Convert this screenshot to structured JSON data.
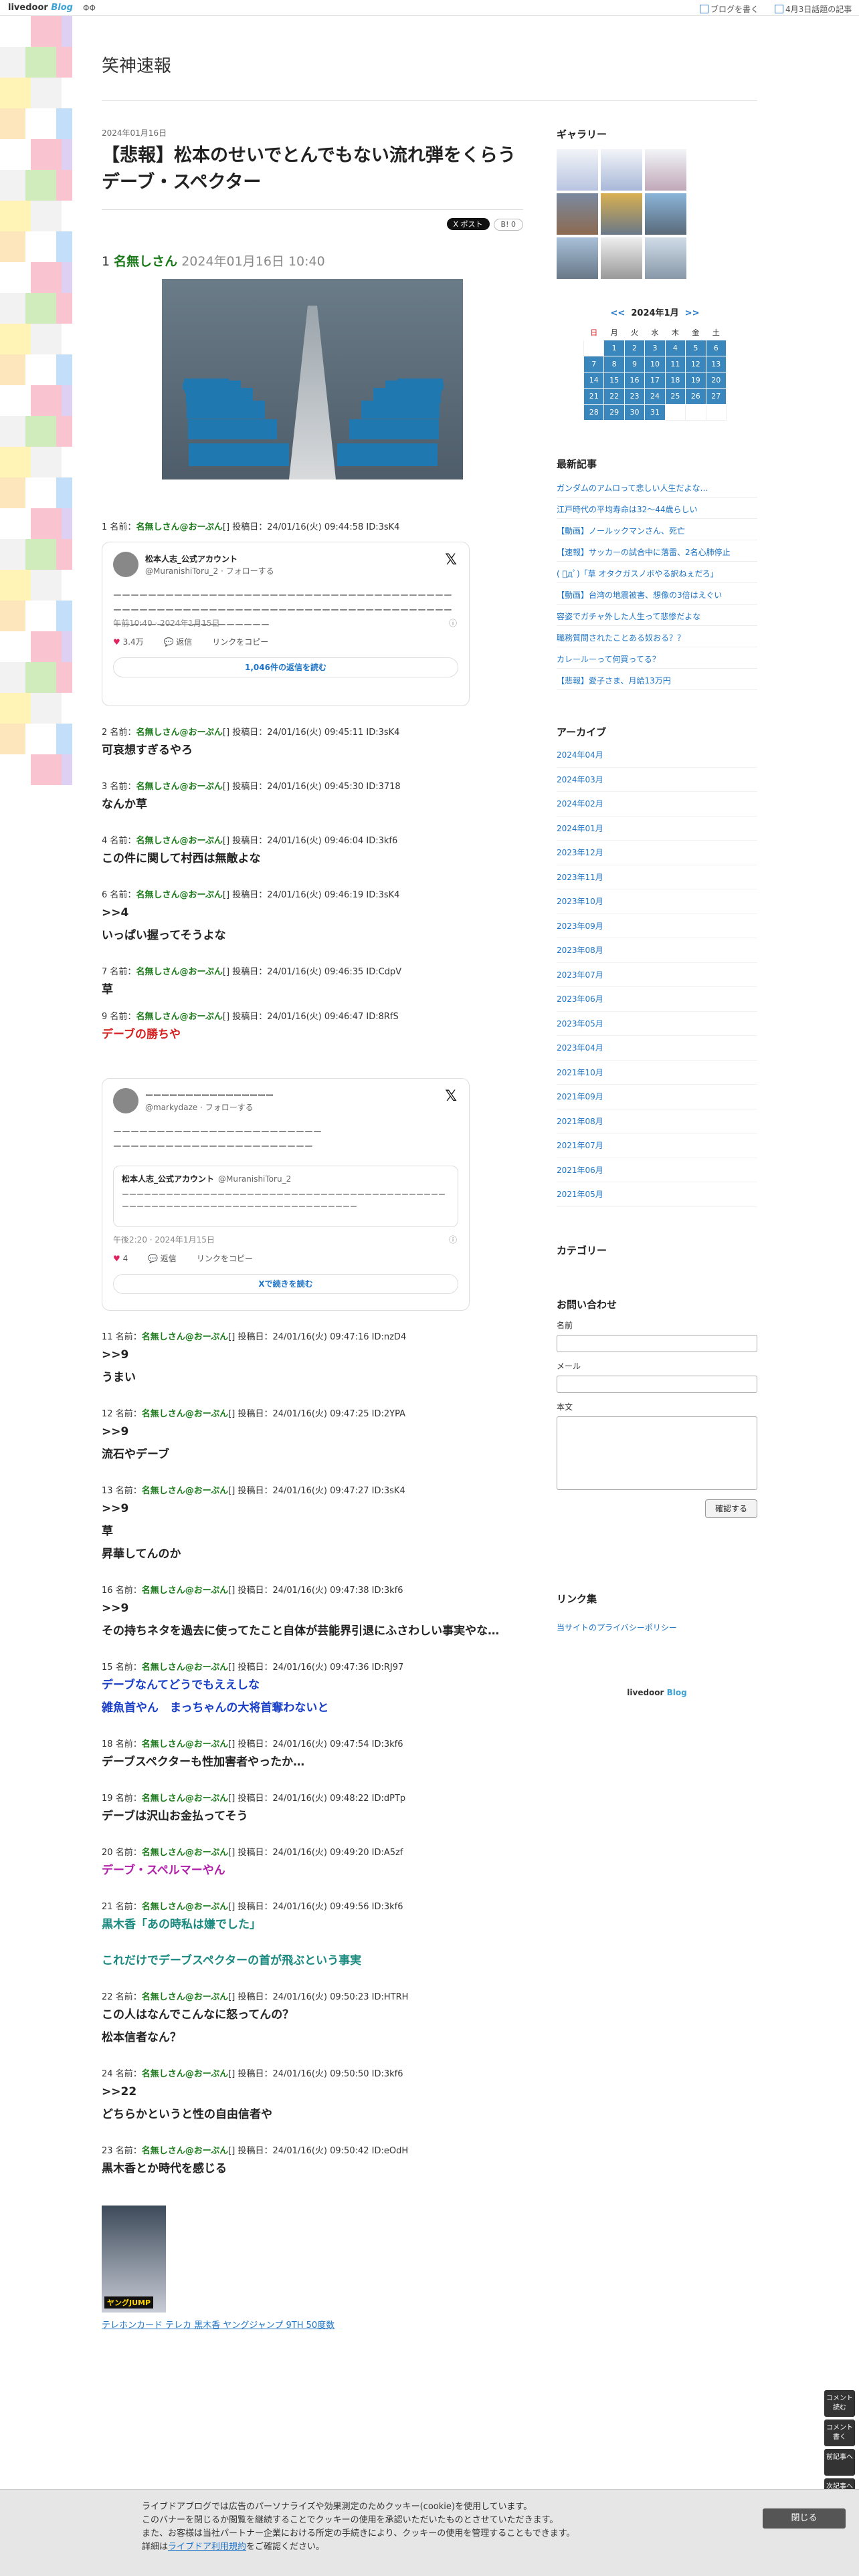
{
  "topbar": {
    "logo_a": "livedoor",
    "logo_b": "Blog",
    "nav": "ΦΦ",
    "write": "ブログを書く",
    "days": "4月3日話題の記事"
  },
  "site": {
    "title": "笑神速報"
  },
  "article": {
    "date": "2024年01月16日",
    "title": "【悲報】松本のせいでとんでもない流れ弾をくらうデーブ・スペクター",
    "share_x": "X ポスト",
    "share_b": "B! 0",
    "first": {
      "num": "1",
      "name": "名無しさん",
      "date": "2024年01月16日 10:40"
    }
  },
  "tweet1": {
    "name": "松本人志_公式アカウント",
    "handle": "@MuranishiToru_2 · フォローする",
    "text": "ーーーーーーーーーーーーーーーーーーーーーーーーーーーーーーーーーーーーーーーーーーーーーーーーーーーーーーーーーーーーーーーーーーーーーーーーーーーーーーーーーーーーーーーーーーーーーーーー",
    "meta": "午前10:40 · 2024年1月15日",
    "likes": "3.4万",
    "reply": "返信",
    "copy": "リンクをコピー",
    "more": "1,046件の返信を読む"
  },
  "tweet2": {
    "name": "ーーーーーーーーーーーーーーーー",
    "handle": "@markydaze · フォローする",
    "text1": "ーーーーーーーーーーーーーーーーーーーーーーーー",
    "text2": "ーーーーーーーーーーーーーーーーーーーーーーー",
    "q_name": "松本人志_公式アカウント",
    "q_handle": "@MuranishiToru_2",
    "q_text": "ーーーーーーーーーーーーーーーーーーーーーーーーーーーーーーーーーーーーーーーーーーーーーーーーーーーーーーーーーーーーーーーーーーーーーーーーーーーー",
    "meta": "午後2:20 · 2024年1月15日",
    "likes": "4",
    "reply": "返信",
    "copy": "リンクをコピー",
    "more": "Xで続きを読む"
  },
  "res": [
    {
      "num": "1",
      "id": "24/01/16(火) 09:44:58 ID:3sK4",
      "lines": []
    },
    {
      "num": "2",
      "id": "24/01/16(火) 09:45:11 ID:3sK4",
      "lines": [
        "可哀想すぎるやろ"
      ]
    },
    {
      "num": "3",
      "id": "24/01/16(火) 09:45:30 ID:3718",
      "lines": [
        "なんか草"
      ]
    },
    {
      "num": "4",
      "id": "24/01/16(火) 09:46:04 ID:3kf6",
      "lines": [
        "この件に関して村西は無敵よな"
      ]
    },
    {
      "num": "6",
      "id": "24/01/16(火) 09:46:19 ID:3sK4",
      "lines": [
        ">>4",
        "いっぱい握ってそうよな"
      ]
    },
    {
      "num": "7",
      "id": "24/01/16(火) 09:46:35 ID:CdpV",
      "lines": [
        "草"
      ]
    },
    {
      "num": "9",
      "id": "24/01/16(火) 09:46:47 ID:8RfS",
      "lines": [
        "デーブの勝ちや"
      ]
    },
    {
      "num": "11",
      "id": "24/01/16(火) 09:47:16 ID:nzD4",
      "lines": [
        ">>9",
        "うまい"
      ]
    },
    {
      "num": "12",
      "id": "24/01/16(火) 09:47:25 ID:2YPA",
      "lines": [
        ">>9",
        "流石やデーブ"
      ]
    },
    {
      "num": "13",
      "id": "24/01/16(火) 09:47:27 ID:3sK4",
      "lines": [
        ">>9",
        "草",
        "昇華してんのか"
      ]
    },
    {
      "num": "16",
      "id": "24/01/16(火) 09:47:38 ID:3kf6",
      "lines": [
        ">>9",
        "その持ちネタを過去に使ってたこと自体が芸能界引退にふさわしい事実やな…"
      ]
    },
    {
      "num": "15",
      "id": "24/01/16(火) 09:47:36 ID:RJ97",
      "lines": [
        "デーブなんてどうでもええしな",
        "雑魚首やん　まっちゃんの大将首奪わないと"
      ]
    },
    {
      "num": "18",
      "id": "24/01/16(火) 09:47:54 ID:3kf6",
      "lines": [
        "デーブスペクターも性加害者やったか…"
      ]
    },
    {
      "num": "19",
      "id": "24/01/16(火) 09:48:22 ID:dPTp",
      "lines": [
        "デーブは沢山お金払ってそう"
      ]
    },
    {
      "num": "20",
      "id": "24/01/16(火) 09:49:20 ID:A5zf",
      "lines": [
        "デーブ・スペルマーやん"
      ]
    },
    {
      "num": "21",
      "id": "24/01/16(火) 09:49:56 ID:3kf6",
      "lines": [
        "黒木香「あの時私は嫌でした」",
        "",
        "これだけでデーブスペクターの首が飛ぶという事実"
      ]
    },
    {
      "num": "22",
      "id": "24/01/16(火) 09:50:23 ID:HTRH",
      "lines": [
        "この人はなんでこんなに怒ってんの？",
        "松本信者なん？"
      ]
    },
    {
      "num": "24",
      "id": "24/01/16(火) 09:50:50 ID:3kf6",
      "lines": [
        ">>22",
        "どちらかというと性の自由信者や"
      ]
    },
    {
      "num": "23",
      "id": "24/01/16(火) 09:50:42 ID:eOdH",
      "lines": [
        "黒木香とか時代を感じる"
      ]
    }
  ],
  "res_label": {
    "pre": "名前：",
    "name": "名無しさん@おーぷん",
    "post": "[] 投稿日："
  },
  "product": {
    "badge": "ヤングJUMP",
    "link": "テレホンカード テレカ 黒木香 ヤングジャンプ 9TH 50度数"
  },
  "side": {
    "gallery": "ギャラリー",
    "cal_prev": "<<",
    "cal_title": "2024年1月",
    "cal_next": ">>",
    "weekdays": [
      "日",
      "月",
      "火",
      "水",
      "木",
      "金",
      "土"
    ],
    "latest": "最新記事",
    "latest_items": [
      "ガンダムのアムロって悲しい人生だよな…",
      "江戸時代の平均寿命は32〜44歳らしい",
      "【動画】ノールックマンさん、死亡",
      "【速報】サッカーの試合中に落雷、2名心肺停止",
      "( ﾟдﾟ)「草 オタクガスノボやる訳ねぇだろ」",
      "【動画】台湾の地震被害、想像の3倍はえぐい",
      "容姿でガチャ外した人生って悲惨だよな",
      "職務質問されたことある奴おる？？",
      "カレールーって何買ってる？",
      "【悲報】愛子さま、月給13万円"
    ],
    "archive": "アーカイブ",
    "archive_items": [
      "2024年04月",
      "2024年03月",
      "2024年02月",
      "2024年01月",
      "2023年12月",
      "2023年11月",
      "2023年10月",
      "2023年09月",
      "2023年08月",
      "2023年07月",
      "2023年06月",
      "2023年05月",
      "2023年04月",
      "2021年10月",
      "2021年09月",
      "2021年08月",
      "2021年07月",
      "2021年06月",
      "2021年05月"
    ],
    "category": "カテゴリー",
    "contact": "お問い合わせ",
    "f_name": "名前",
    "f_mail": "メール",
    "f_body": "本文",
    "f_btn": "確認する",
    "links": "リンク集",
    "privacy": "当サイトのプライバシーポリシー",
    "lv_a": "livedoor",
    "lv_b": "Blog"
  },
  "cookie": {
    "l1": "ライブドアブログでは広告のパーソナライズや効果測定のためクッキー(cookie)を使用しています。",
    "l2": "このバナーを閉じるか閲覧を継続することでクッキーの使用を承認いただいたものとさせていただきます。",
    "l3": "また、お客様は当社パートナー企業における所定の手続きにより、クッキーの使用を管理することもできます。",
    "l4a": "詳細は",
    "l4b": "ライブドア利用規約",
    "l4c": "をご確認ください。",
    "close": "閉じる"
  },
  "rtools": [
    "コメント読む",
    "コメント書く",
    "前記事へ",
    "次記事へ"
  ],
  "colors": {
    "name_green": "#1a7a1a",
    "link_blue": "#1d74c6",
    "accent_red": "#d62020"
  }
}
